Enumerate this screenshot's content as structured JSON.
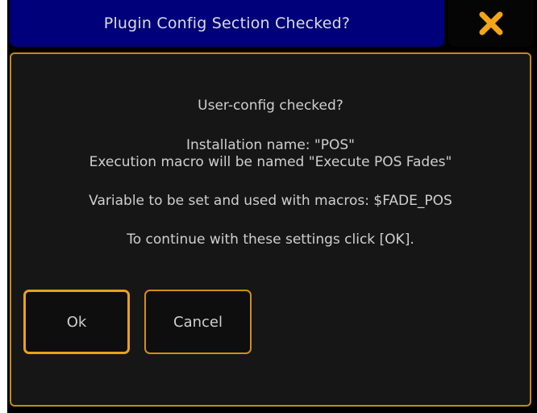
{
  "dialog": {
    "title": "Plugin Config Section Checked?",
    "close_icon": "close-x-icon",
    "accent_color": "#e7a21a",
    "title_bg_color": "#00007a"
  },
  "message": {
    "line1": "User-config checked?",
    "line2": "Installation name: \"POS\"",
    "line3": "Execution macro will be named \"Execute POS Fades\"",
    "line4": "Variable to be set and used with macros: $FADE_POS",
    "line5": "To continue with these settings click [OK]."
  },
  "buttons": {
    "ok_label": "Ok",
    "cancel_label": "Cancel"
  }
}
